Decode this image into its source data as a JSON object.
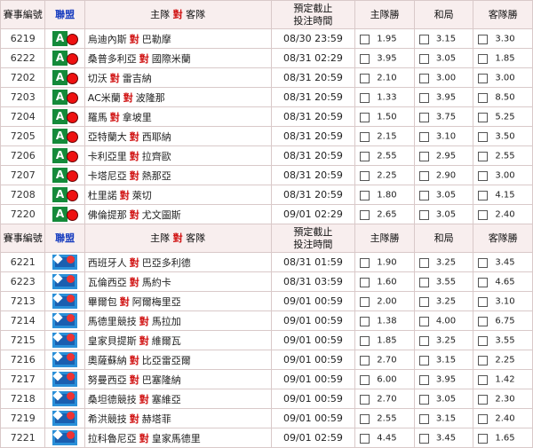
{
  "header": {
    "no": "賽事編號",
    "league": "聯盟",
    "teams_home": "主隊",
    "teams_vs": "對",
    "teams_away": "客隊",
    "time_line1": "預定截止",
    "time_line2": "投注時間",
    "home_win": "主隊勝",
    "draw": "和局",
    "away_win": "客隊勝"
  },
  "vs_label": "對",
  "sections": [
    {
      "badge": "A",
      "rows": [
        {
          "no": "6219",
          "home": "烏迪內斯",
          "away": "巴勒摩",
          "time": "08/30 23:59",
          "h": "1.95",
          "d": "3.15",
          "a": "3.30"
        },
        {
          "no": "6222",
          "home": "桑普多利亞",
          "away": "國際米蘭",
          "time": "08/31 02:29",
          "h": "3.95",
          "d": "3.05",
          "a": "1.85"
        },
        {
          "no": "7202",
          "home": "切沃",
          "away": "雷吉納",
          "time": "08/31 20:59",
          "h": "2.10",
          "d": "3.00",
          "a": "3.00"
        },
        {
          "no": "7203",
          "home": "AC米蘭",
          "away": "波隆那",
          "time": "08/31 20:59",
          "h": "1.33",
          "d": "3.95",
          "a": "8.50"
        },
        {
          "no": "7204",
          "home": "羅馬",
          "away": "拿坡里",
          "time": "08/31 20:59",
          "h": "1.50",
          "d": "3.75",
          "a": "5.25"
        },
        {
          "no": "7205",
          "home": "亞特蘭大",
          "away": "西耶納",
          "time": "08/31 20:59",
          "h": "2.15",
          "d": "3.10",
          "a": "3.50"
        },
        {
          "no": "7206",
          "home": "卡利亞里",
          "away": "拉齊歐",
          "time": "08/31 20:59",
          "h": "2.55",
          "d": "2.95",
          "a": "2.55"
        },
        {
          "no": "7207",
          "home": "卡塔尼亞",
          "away": "熱那亞",
          "time": "08/31 20:59",
          "h": "2.25",
          "d": "2.90",
          "a": "3.00"
        },
        {
          "no": "7208",
          "home": "杜里諾",
          "away": "萊切",
          "time": "08/31 20:59",
          "h": "1.80",
          "d": "3.05",
          "a": "4.15"
        },
        {
          "no": "7220",
          "home": "佛倫提那",
          "away": "尤文圖斯",
          "time": "09/01 02:29",
          "h": "2.65",
          "d": "3.05",
          "a": "2.40"
        }
      ]
    },
    {
      "badge": "B",
      "rows": [
        {
          "no": "6221",
          "home": "西班牙人",
          "away": "巴亞多利德",
          "time": "08/31 01:59",
          "h": "1.90",
          "d": "3.25",
          "a": "3.45"
        },
        {
          "no": "6223",
          "home": "瓦倫西亞",
          "away": "馬約卡",
          "time": "08/31 03:59",
          "h": "1.60",
          "d": "3.55",
          "a": "4.65"
        },
        {
          "no": "7213",
          "home": "畢爾包",
          "away": "阿爾梅里亞",
          "time": "09/01 00:59",
          "h": "2.00",
          "d": "3.25",
          "a": "3.10"
        },
        {
          "no": "7214",
          "home": "馬德里競技",
          "away": "馬拉加",
          "time": "09/01 00:59",
          "h": "1.38",
          "d": "4.00",
          "a": "6.75"
        },
        {
          "no": "7215",
          "home": "皇家貝提斯",
          "away": "維爾瓦",
          "time": "09/01 00:59",
          "h": "1.85",
          "d": "3.25",
          "a": "3.55"
        },
        {
          "no": "7216",
          "home": "奧薩蘇納",
          "away": "比亞雷亞爾",
          "time": "09/01 00:59",
          "h": "2.70",
          "d": "3.15",
          "a": "2.25"
        },
        {
          "no": "7217",
          "home": "努曼西亞",
          "away": "巴塞隆納",
          "time": "09/01 00:59",
          "h": "6.00",
          "d": "3.95",
          "a": "1.42"
        },
        {
          "no": "7218",
          "home": "桑坦德競技",
          "away": "塞維亞",
          "time": "09/01 00:59",
          "h": "2.70",
          "d": "3.05",
          "a": "2.30"
        },
        {
          "no": "7219",
          "home": "希洪競技",
          "away": "赫塔菲",
          "time": "09/01 00:59",
          "h": "2.55",
          "d": "3.15",
          "a": "2.40"
        },
        {
          "no": "7221",
          "home": "拉科魯尼亞",
          "away": "皇家馬德里",
          "time": "09/01 02:59",
          "h": "4.45",
          "d": "3.45",
          "a": "1.65"
        }
      ]
    }
  ]
}
